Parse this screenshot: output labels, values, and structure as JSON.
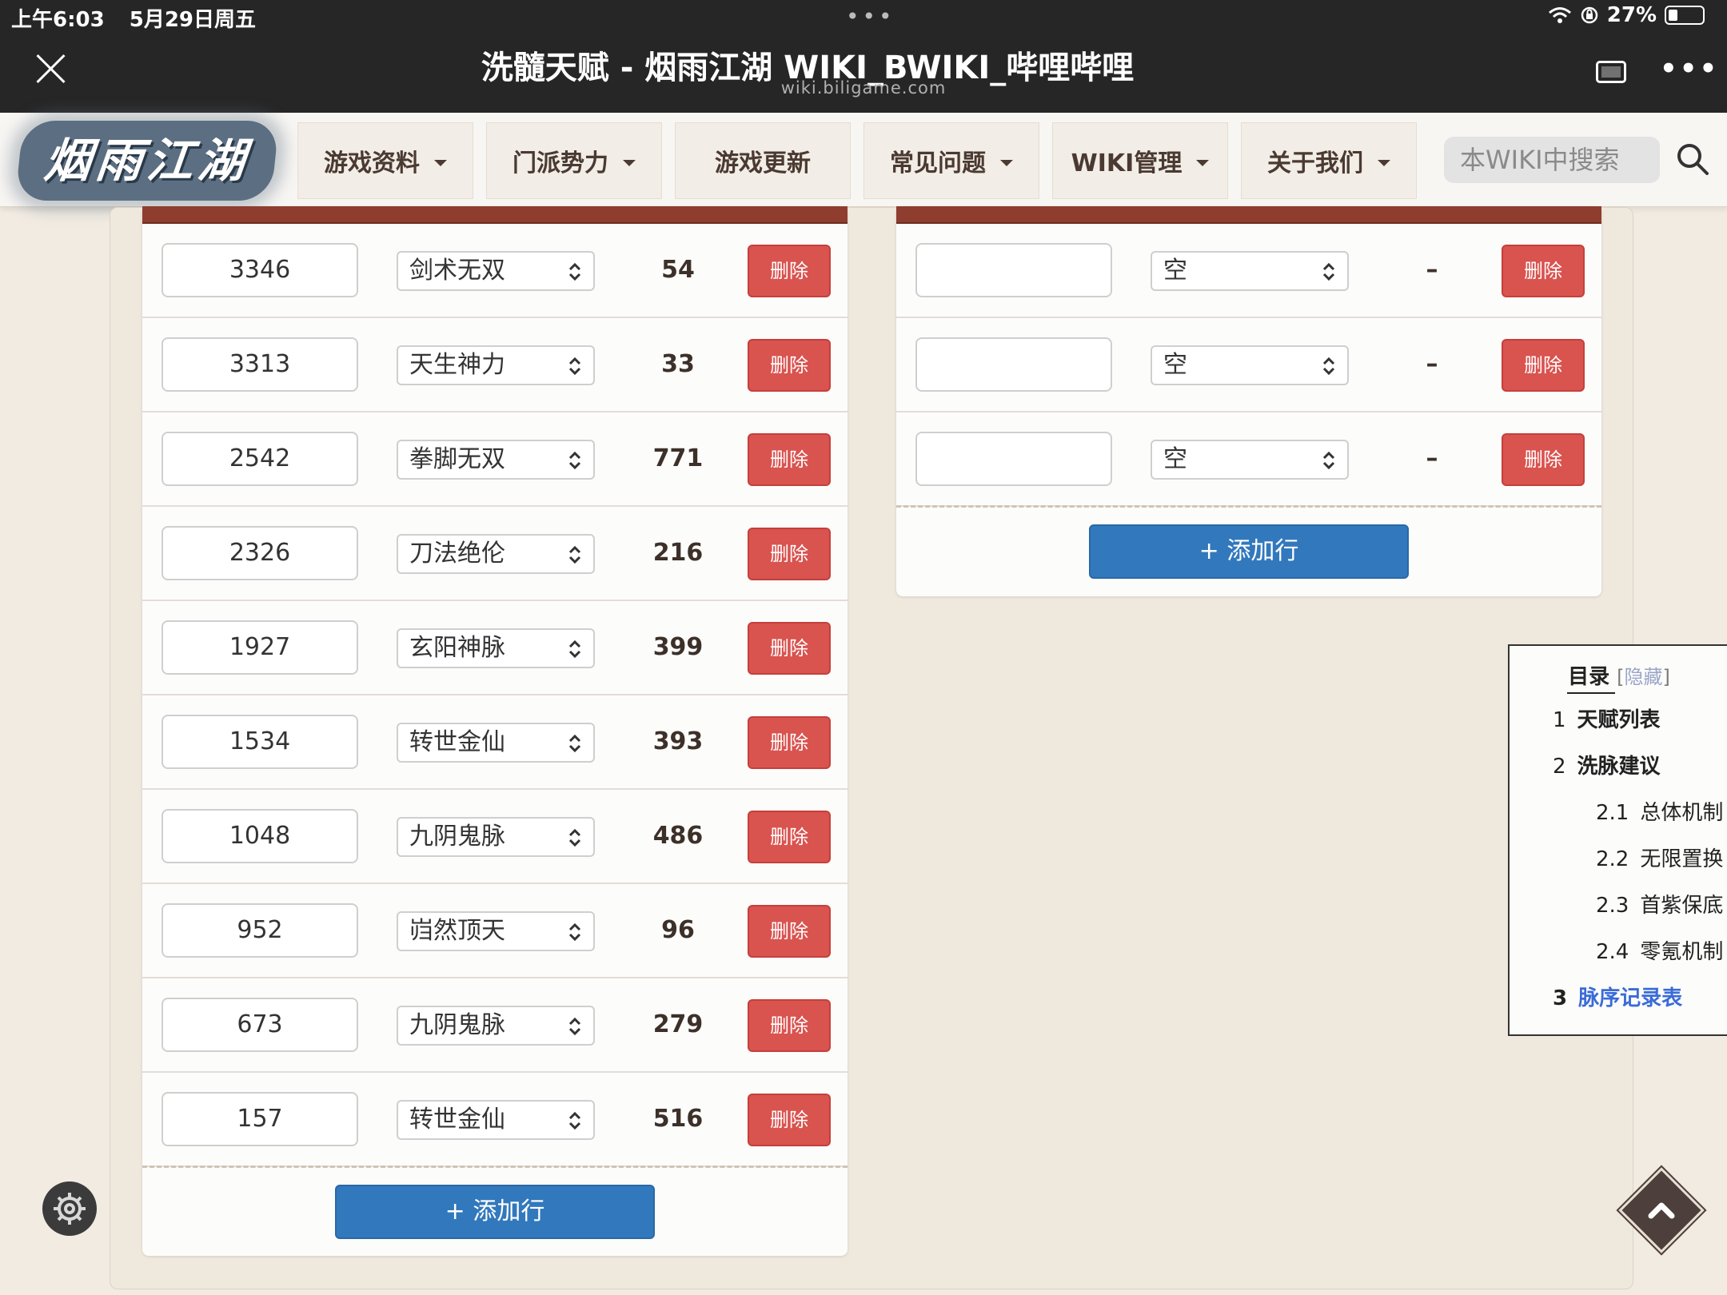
{
  "status_bar": {
    "time": "上午6:03",
    "date": "5月29日周五",
    "battery": "27%",
    "battery_level": 0.27,
    "dots": "•••"
  },
  "browser": {
    "title": "洗髓天赋 - 烟雨江湖 WIKI_BWIKI_哔哩哔哩",
    "url": "wiki.biligame.com",
    "more": "•••"
  },
  "site": {
    "logo_text": "烟雨江湖",
    "nav": [
      "游戏资料",
      "门派势力",
      "游戏更新",
      "常见问题",
      "WIKI管理",
      "关于我们"
    ],
    "nav_has_dropdown": [
      true,
      true,
      false,
      true,
      true,
      true
    ],
    "search_placeholder": "本WIKI中搜索"
  },
  "left_table": {
    "rows": [
      {
        "number": "3346",
        "talent": "剑术无双",
        "value": "54",
        "delete": "删除"
      },
      {
        "number": "3313",
        "talent": "天生神力",
        "value": "33",
        "delete": "删除"
      },
      {
        "number": "2542",
        "talent": "拳脚无双",
        "value": "771",
        "delete": "删除"
      },
      {
        "number": "2326",
        "talent": "刀法绝伦",
        "value": "216",
        "delete": "删除"
      },
      {
        "number": "1927",
        "talent": "玄阳神脉",
        "value": "399",
        "delete": "删除"
      },
      {
        "number": "1534",
        "talent": "转世金仙",
        "value": "393",
        "delete": "删除"
      },
      {
        "number": "1048",
        "talent": "九阴鬼脉",
        "value": "486",
        "delete": "删除"
      },
      {
        "number": "952",
        "talent": "岿然顶天",
        "value": "96",
        "delete": "删除"
      },
      {
        "number": "673",
        "talent": "九阴鬼脉",
        "value": "279",
        "delete": "删除"
      },
      {
        "number": "157",
        "talent": "转世金仙",
        "value": "516",
        "delete": "删除"
      }
    ],
    "add_row": "+ 添加行"
  },
  "right_table": {
    "rows": [
      {
        "number": "",
        "talent": "空",
        "value": "–",
        "delete": "删除"
      },
      {
        "number": "",
        "talent": "空",
        "value": "–",
        "delete": "删除"
      },
      {
        "number": "",
        "talent": "空",
        "value": "–",
        "delete": "删除"
      }
    ],
    "add_row": "+ 添加行"
  },
  "toc": {
    "title": "目录",
    "hide_open": "[",
    "hide_label": "隐藏",
    "hide_close": "]",
    "items": [
      {
        "num": "1",
        "label": "天赋列表",
        "level": 1
      },
      {
        "num": "2",
        "label": "洗脉建议",
        "level": 1
      },
      {
        "num": "2.1",
        "label": "总体机制",
        "level": 2
      },
      {
        "num": "2.2",
        "label": "无限置换",
        "level": 2
      },
      {
        "num": "2.3",
        "label": "首紫保底",
        "level": 2
      },
      {
        "num": "2.4",
        "label": "零氪机制",
        "level": 2
      },
      {
        "num": "3",
        "label": "脉序记录表",
        "level": 1,
        "active": true
      }
    ]
  },
  "colors": {
    "delete_button": "#d9534f",
    "add_button": "#3278bd",
    "table_header_bar": "#8e3d2f",
    "toc_active": "#3a6bd8"
  },
  "icons": {
    "close": "close-icon",
    "tabs": "tabs-icon",
    "search": "search-icon",
    "settings": "gear-icon",
    "scroll_top": "chevron-up-icon",
    "select": "updown-chevron-icon",
    "wifi": "wifi-icon",
    "battery": "battery-icon"
  }
}
